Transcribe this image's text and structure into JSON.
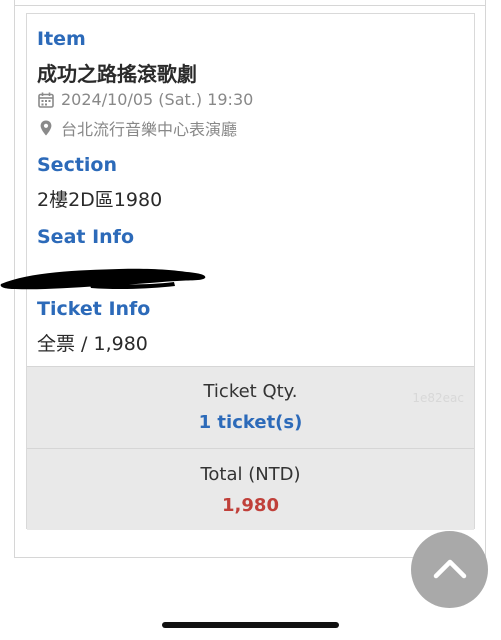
{
  "item": {
    "label": "Item",
    "title": "成功之路搖滾歌劇",
    "datetime": "2024/10/05 (Sat.) 19:30",
    "venue": "台北流行音樂中心表演廳"
  },
  "section": {
    "label": "Section",
    "value": "2樓2D區1980"
  },
  "seat": {
    "label": "Seat Info",
    "value_redacted": true
  },
  "ticket": {
    "label": "Ticket Info",
    "value": "全票 / 1,980"
  },
  "quantity": {
    "label": "Ticket Qty.",
    "value": "1 ticket(s)",
    "watermark": "1e82eac"
  },
  "total": {
    "label": "Total (NTD)",
    "value": "1,980"
  },
  "colors": {
    "accent_blue": "#2c6ab9",
    "total_red": "#c0403a",
    "panel_gray": "#e9e9e9"
  },
  "icons": {
    "calendar": "calendar-icon",
    "location": "location-pin-icon",
    "scroll_top": "chevron-up-icon"
  }
}
